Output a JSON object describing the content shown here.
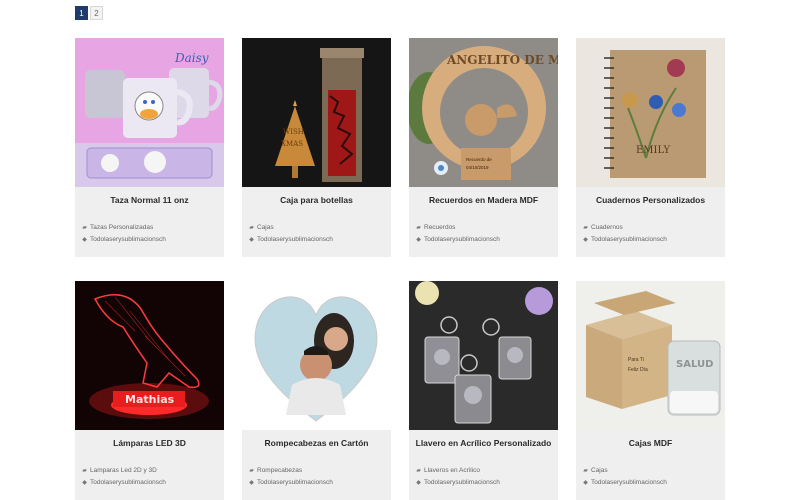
{
  "pagination": {
    "pages": [
      "1",
      "2"
    ],
    "current": "1"
  },
  "products": [
    {
      "title": "Taza Normal 11 onz",
      "category": "Tazas Personalizadas",
      "tag": "Todolaserysublimacionsch",
      "image": "mugs-daisy-duck"
    },
    {
      "title": "Caja para botellas",
      "category": "Cajas",
      "tag": "Todolaserysublimacionsch",
      "image": "wooden-bottle-box"
    },
    {
      "title": "Recuerdos en Madera MDF",
      "category": "Recuerdos",
      "tag": "Todolaserysublimacionsch",
      "image": "angel-wood-souvenir",
      "image_text": "ANGELITO DE MI GUARDA"
    },
    {
      "title": "Cuadernos Personalizados",
      "category": "Cuadernos",
      "tag": "Todolaserysublimacionsch",
      "image": "kraft-notebook-flowers",
      "image_text": "EMILY"
    },
    {
      "title": "Lámparas LED 3D",
      "category": "Lamparas Led 2D y 3D",
      "tag": "Todolaserysublimacionsch",
      "image": "dinosaur-led-lamp",
      "image_text": "Mathias"
    },
    {
      "title": "Rompecabezas en Cartón",
      "category": "Rompecabezas",
      "tag": "Todolaserysublimacionsch",
      "image": "heart-photo-puzzle"
    },
    {
      "title": "Llavero en Acrílico Personalizado",
      "category": "Llaveros en Acrilico",
      "tag": "Todolaserysublimacionsch",
      "image": "acrylic-keychains"
    },
    {
      "title": "Cajas MDF",
      "category": "Cajas",
      "tag": "Todolaserysublimacionsch",
      "image": "mdf-box-glass",
      "image_text": "SALUD"
    }
  ],
  "icons": {
    "category": "folder-icon",
    "tag": "tag-icon"
  },
  "colors": {
    "accent": "#1d3b6b",
    "card_bg": "#efefef"
  }
}
